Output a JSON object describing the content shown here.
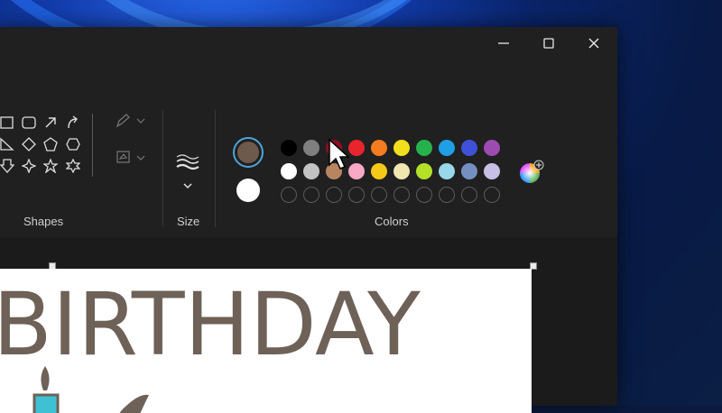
{
  "window": {
    "controls": {
      "minimize": "minimize",
      "maximize": "maximize",
      "close": "close"
    }
  },
  "ribbon": {
    "shapes_label": "Shapes",
    "size_label": "Size",
    "colors_label": "Colors"
  },
  "colors": {
    "primary": "#6e5a4d",
    "secondary": "#ffffff",
    "row1": [
      "#000000",
      "#7f7f7f",
      "#8b1020",
      "#e8242c",
      "#f57c20",
      "#f1df1e",
      "#26b14c",
      "#1e9fe6",
      "#3f51d9",
      "#9c4bb0"
    ],
    "row2": [
      "#ffffff",
      "#c3c3c3",
      "#b98560",
      "#f9a9c5",
      "#f6c918",
      "#efe6b0",
      "#b4e02a",
      "#99d8ea",
      "#7590c0",
      "#c8bfe7"
    ],
    "custom_count": 10
  },
  "canvas": {
    "text": "BIRTHDAY",
    "text_color": "#6e6158"
  }
}
